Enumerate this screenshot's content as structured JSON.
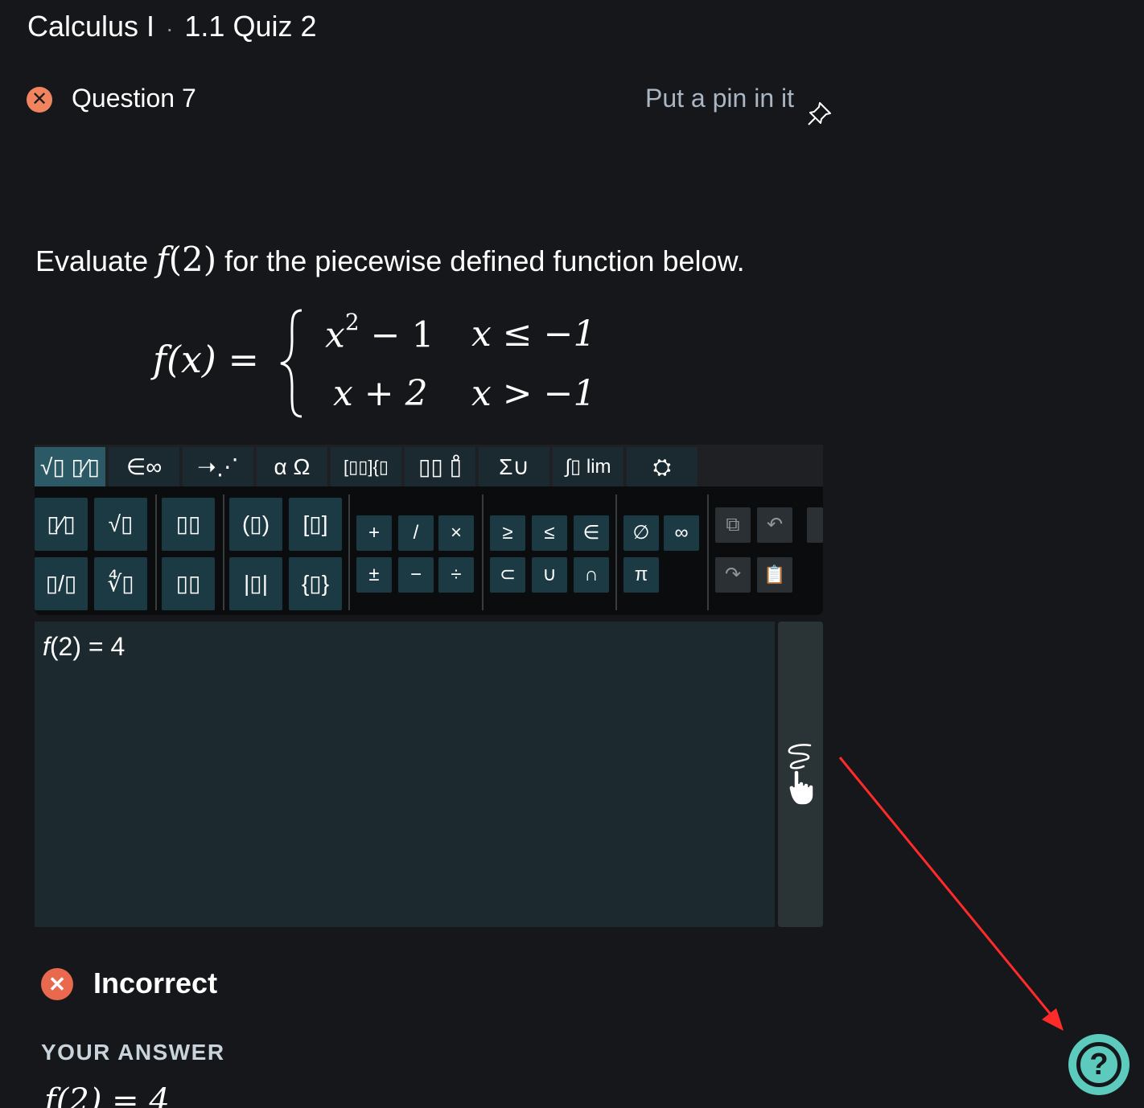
{
  "header": {
    "course": "Calculus I",
    "separator": "·",
    "quiz": "1.1 Quiz 2"
  },
  "question": {
    "status_icon": "x-circle-icon",
    "title": "Question 7",
    "pin_label": "Put a pin in it",
    "pin_icon": "pushpin-icon"
  },
  "prompt": {
    "before": "Evaluate ",
    "fn": "f",
    "arg": "(2)",
    "after": " for the piecewise defined function below."
  },
  "piecewise": {
    "lhs": "f(x) =",
    "row1_expr_base": "x",
    "row1_expr_exp": "2",
    "row1_expr_rest": " − 1",
    "row1_cond": "x ≤ −1",
    "row2_expr": "x + 2",
    "row2_cond": "x > −1"
  },
  "toolbar": {
    "tabs": [
      {
        "label": "√▯ ▯⁄▯",
        "active": true
      },
      {
        "label": "∈∞"
      },
      {
        "label": "➝⋰"
      },
      {
        "label": "α Ω"
      },
      {
        "label": "[▯▯]{▯"
      },
      {
        "label": "▯▯ ▯̊"
      },
      {
        "label": "Σ∪"
      },
      {
        "label": "∫▯ lim"
      },
      {
        "label": "⛭"
      }
    ],
    "keys": {
      "fraction": "▯⁄▯",
      "sqrt": "√▯",
      "superscript": "▯▯",
      "parens": "(▯)",
      "brackets": "[▯]",
      "plus": "+",
      "slash": "/",
      "times": "×",
      "geq": "≥",
      "leq": "≤",
      "elem": "∈",
      "empty": "∅",
      "inf": "∞",
      "mixed_frac": "▯/▯",
      "nth_root": "∜▯",
      "subscript": "▯▯",
      "abs": "|▯|",
      "braces": "{▯}",
      "plusminus": "±",
      "minus": "−",
      "divide": "÷",
      "subset": "⊂",
      "union": "∪",
      "intersect": "∩",
      "pi": "π",
      "copy": "⧉",
      "undo": "↶",
      "redo": "↷",
      "paste": "📋"
    }
  },
  "answer_input": {
    "lhs_fn": "f",
    "lhs_rest": "(2)",
    "eq": " = ",
    "value": "4"
  },
  "feedback": {
    "status": "Incorrect",
    "icon": "x-circle-icon",
    "your_answer_label": "YOUR ANSWER",
    "your_answer": "f(2) = 4"
  },
  "help": {
    "icon": "question-mark-icon"
  },
  "annotation": {
    "color": "#ff2a2a"
  }
}
